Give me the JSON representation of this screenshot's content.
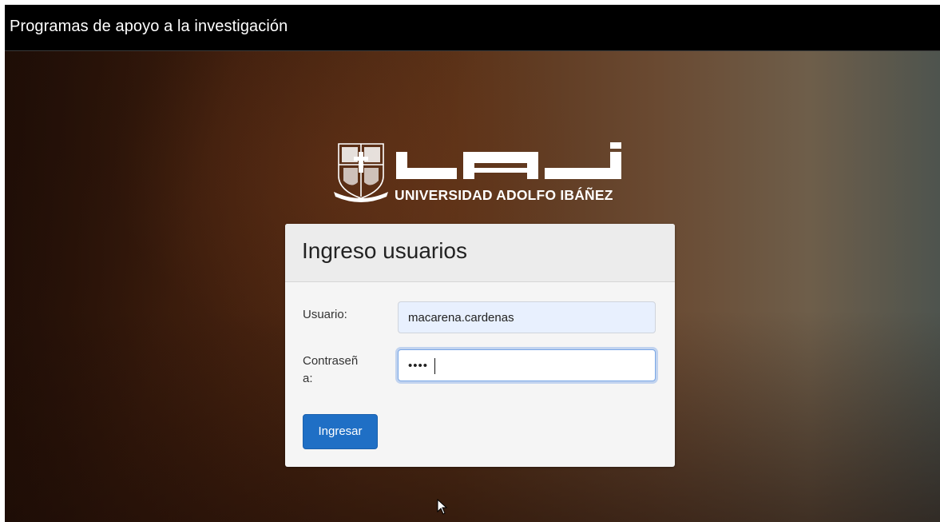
{
  "navbar": {
    "title": "Programas de apoyo a la investigación"
  },
  "logo": {
    "text": "UNIVERSIDAD ADOLFO IBÁÑEZ"
  },
  "login": {
    "heading": "Ingreso usuarios",
    "user_label": "Usuario:",
    "user_value": "macarena.cardenas",
    "password_label": "Contraseña:",
    "password_masked": "••••",
    "submit_label": "Ingresar"
  },
  "colors": {
    "navbar_bg": "#000000",
    "button_bg": "#1f6fc5",
    "autofill_bg": "#e8f0fe",
    "focus_border": "#7aa7e6"
  },
  "icons": {
    "cursor": "arrow-cursor-icon",
    "crest": "university-crest-icon"
  }
}
